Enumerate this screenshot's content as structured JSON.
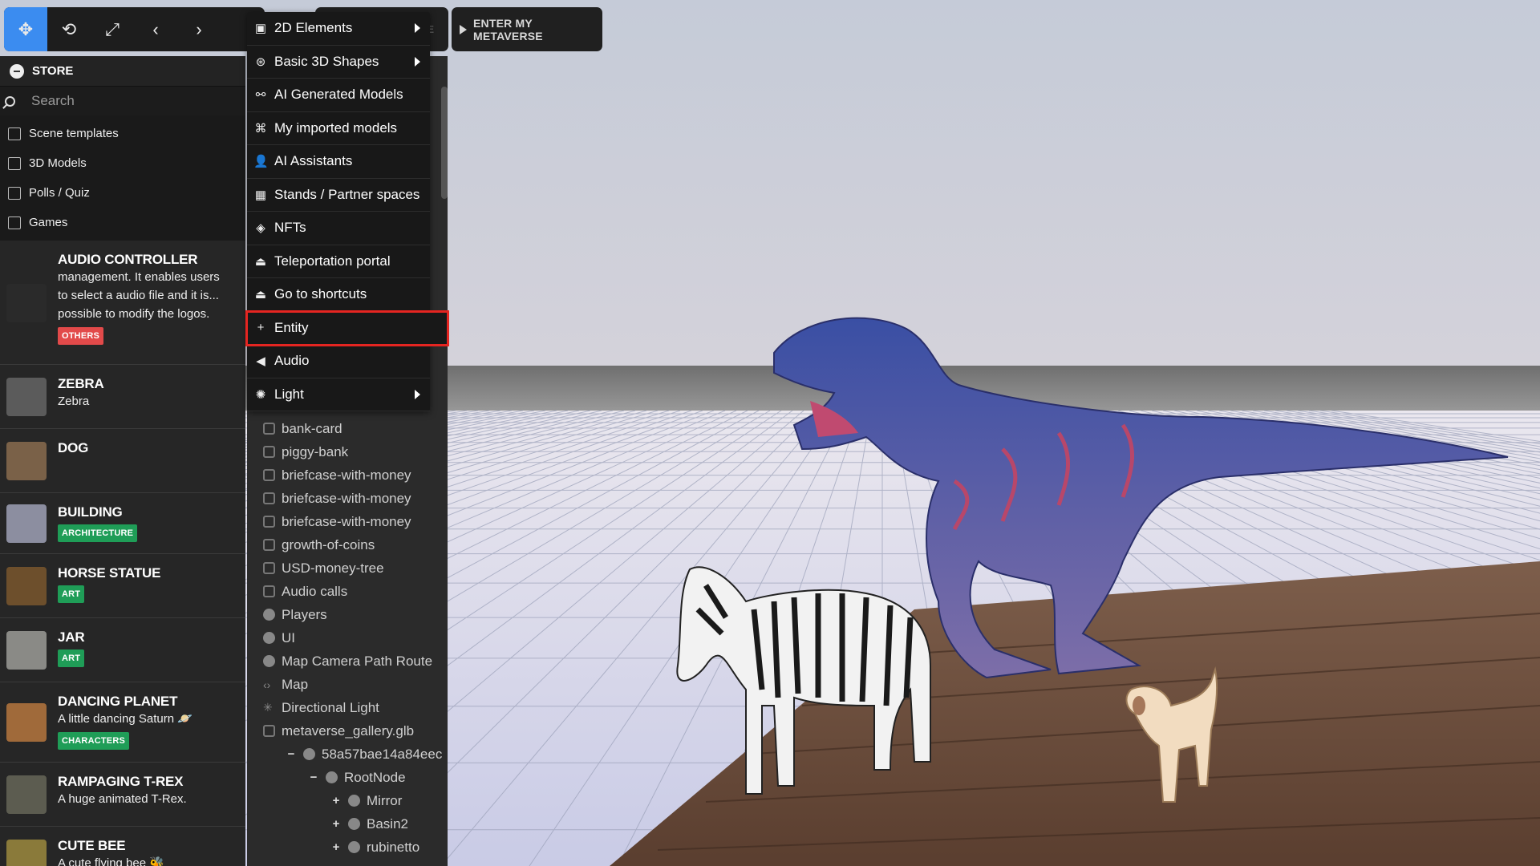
{
  "toolbar": {
    "buttons": [
      {
        "name": "move-tool",
        "glyph": "✥"
      },
      {
        "name": "rotate-tool",
        "glyph": "⟲"
      },
      {
        "name": "scale-tool",
        "glyph": "⤢"
      },
      {
        "name": "undo",
        "glyph": "‹"
      },
      {
        "name": "redo",
        "glyph": "›"
      }
    ],
    "hidden_label": "E",
    "enter_label": "ENTER MY METAVERSE"
  },
  "store": {
    "title": "STORE",
    "search_placeholder": "Search",
    "filters": [
      "Scene templates",
      "3D Models",
      "Polls / Quiz",
      "Games"
    ],
    "items": [
      {
        "name": "AUDIO CONTROLLER",
        "desc": [
          "management. It enables users",
          "to select a audio file and it is...",
          "possible to modify the logos."
        ],
        "tag": "OTHERS",
        "tag_color": "#e24a4a"
      },
      {
        "name": "ZEBRA",
        "desc": [
          "Zebra"
        ],
        "tag": "",
        "tag_color": ""
      },
      {
        "name": "DOG",
        "desc": [],
        "tag": "",
        "tag_color": ""
      },
      {
        "name": "BUILDING",
        "desc": [],
        "tag": "ARCHITECTURE",
        "tag_color": "#1f9d57"
      },
      {
        "name": "HORSE STATUE",
        "desc": [],
        "tag": "ART",
        "tag_color": "#1f9d57"
      },
      {
        "name": "JAR",
        "desc": [],
        "tag": "ART",
        "tag_color": "#1f9d57"
      },
      {
        "name": "DANCING PLANET",
        "desc": [
          "A little dancing Saturn 🪐"
        ],
        "tag": "CHARACTERS",
        "tag_color": "#1f9d57"
      },
      {
        "name": "RAMPAGING T-REX",
        "desc": [
          "A huge animated T-Rex."
        ],
        "tag": "",
        "tag_color": ""
      },
      {
        "name": "CUTE BEE",
        "desc": [
          "A cute flying bee 🐝"
        ],
        "tag": "",
        "tag_color": "#d62fd0"
      }
    ]
  },
  "menu": {
    "items": [
      {
        "label": "2D Elements",
        "icon": "▣",
        "submenu": true
      },
      {
        "label": "Basic 3D Shapes",
        "icon": "⊛",
        "submenu": true
      },
      {
        "label": "AI Generated Models",
        "icon": "⚯",
        "submenu": false
      },
      {
        "label": "My imported models",
        "icon": "⌘",
        "submenu": false
      },
      {
        "label": "AI Assistants",
        "icon": "👤",
        "submenu": false
      },
      {
        "label": "Stands / Partner spaces",
        "icon": "▦",
        "submenu": false
      },
      {
        "label": "NFTs",
        "icon": "◈",
        "submenu": false
      },
      {
        "label": "Teleportation portal",
        "icon": "⏏",
        "submenu": false
      },
      {
        "label": "Go to shortcuts",
        "icon": "⏏",
        "submenu": false
      },
      {
        "label": "Entity",
        "icon": "+",
        "submenu": false,
        "highlight": true
      },
      {
        "label": "Audio",
        "icon": "◀",
        "submenu": false
      },
      {
        "label": "Light",
        "icon": "✺",
        "submenu": true
      }
    ]
  },
  "hierarchy": {
    "rows": [
      {
        "label": "bank-card",
        "kind": "gear",
        "level": 0
      },
      {
        "label": "piggy-bank",
        "kind": "gear",
        "level": 0
      },
      {
        "label": "briefcase-with-money",
        "kind": "gear",
        "level": 0
      },
      {
        "label": "briefcase-with-money",
        "kind": "gear",
        "level": 0
      },
      {
        "label": "briefcase-with-money",
        "kind": "gear",
        "level": 0
      },
      {
        "label": "growth-of-coins",
        "kind": "gear",
        "level": 0
      },
      {
        "label": "USD-money-tree",
        "kind": "gear",
        "level": 0
      },
      {
        "label": "Audio calls",
        "kind": "gear",
        "level": 0
      },
      {
        "label": "Players",
        "kind": "node",
        "level": 0
      },
      {
        "label": "UI",
        "kind": "node",
        "level": 0
      },
      {
        "label": "Map Camera Path Route",
        "kind": "node",
        "level": 0
      },
      {
        "label": "Map",
        "kind": "code",
        "level": 0
      },
      {
        "label": "Directional Light",
        "kind": "light",
        "level": 0
      },
      {
        "label": "metaverse_gallery.glb",
        "kind": "gear",
        "level": 0
      },
      {
        "label": "58a57bae14a84eec",
        "kind": "node",
        "level": 1,
        "expander": "−"
      },
      {
        "label": "RootNode",
        "kind": "node",
        "level": 2,
        "expander": "−"
      },
      {
        "label": "Mirror",
        "kind": "node",
        "level": 3,
        "expander": "+"
      },
      {
        "label": "Basin2",
        "kind": "node",
        "level": 3,
        "expander": "+"
      },
      {
        "label": "rubinetto",
        "kind": "node",
        "level": 3,
        "expander": "+"
      }
    ]
  }
}
